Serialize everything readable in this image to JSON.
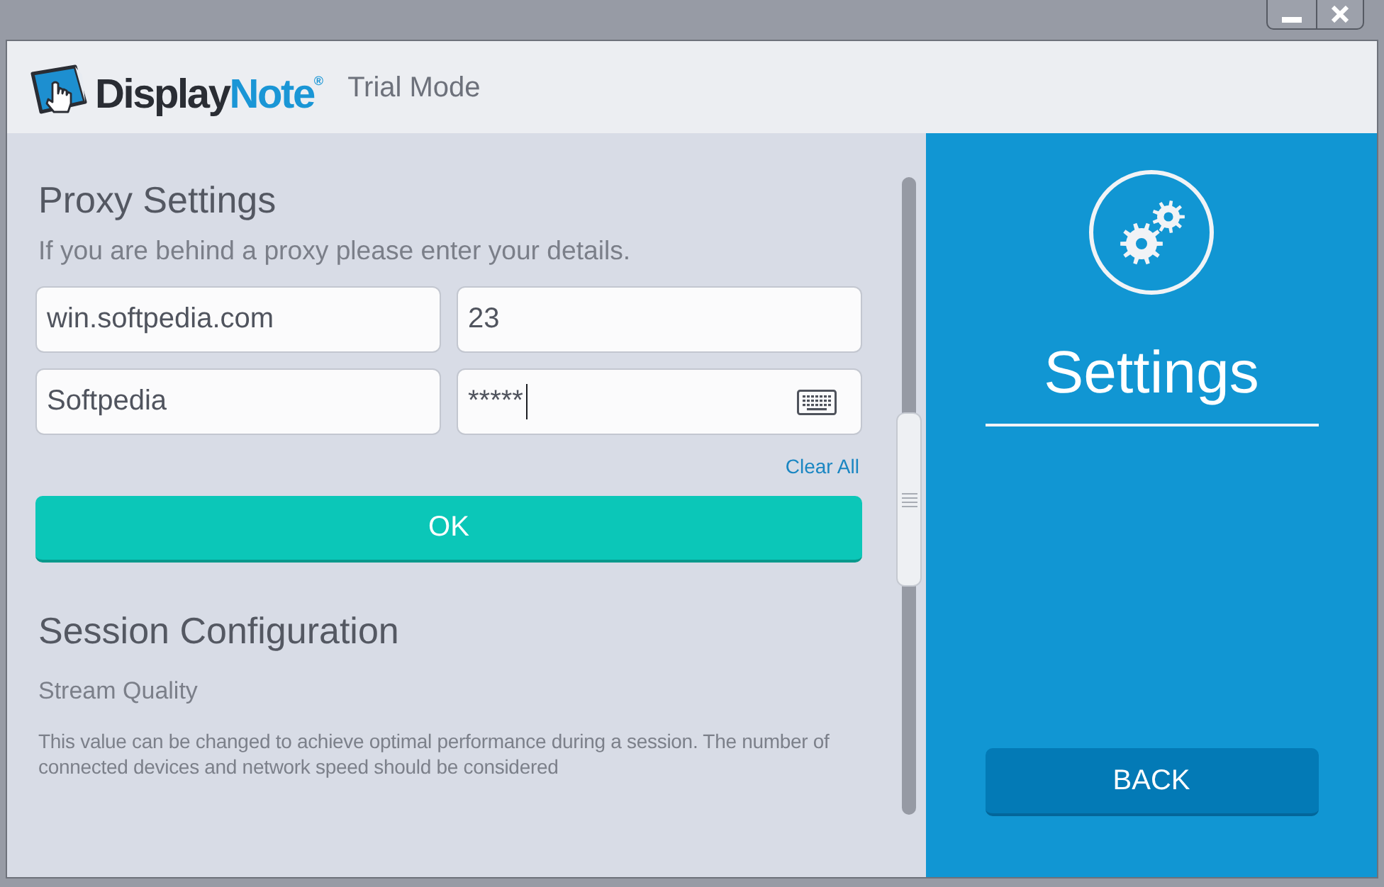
{
  "header": {
    "logo": {
      "word": "Display",
      "accent": "Note",
      "mark": "®"
    },
    "mode": "Trial Mode"
  },
  "proxy": {
    "title": "Proxy Settings",
    "hint": "If you are behind a proxy please enter your details.",
    "fields": [
      {
        "kind": "text",
        "value": "win.softpedia.com",
        "focused": false
      },
      {
        "kind": "text",
        "value": "23",
        "focused": false
      },
      {
        "kind": "text",
        "value": "Softpedia",
        "focused": false
      },
      {
        "kind": "password",
        "value": "*****",
        "focused": true
      }
    ],
    "clear": "Clear All",
    "submit": "OK"
  },
  "session": {
    "title": "Session Configuration",
    "setting": {
      "label": "Stream Quality",
      "description": "This value can be changed to achieve optimal performance during a session. The number of connected devices and network speed should be considered"
    }
  },
  "side": {
    "title": "Settings",
    "back": "BACK"
  }
}
